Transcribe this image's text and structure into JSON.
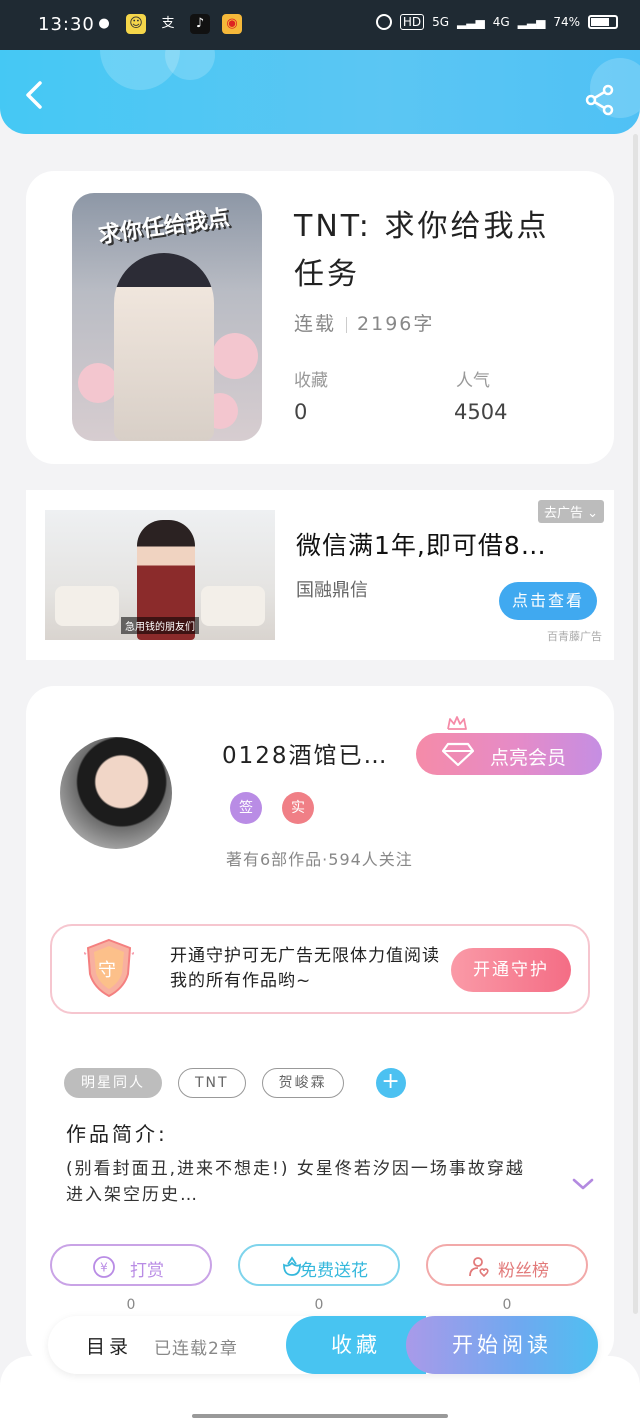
{
  "status_bar": {
    "time": "13:30",
    "apps": [
      "wechat-icon",
      "app-icon",
      "alipay-icon",
      "tiktok-icon",
      "weibo-icon"
    ],
    "hd": "HD",
    "net1": "5G",
    "net2": "4G",
    "battery": "74%"
  },
  "book": {
    "title": "TNT: 求你给我点任务",
    "cover_text": "求你任给我点",
    "status": "连载",
    "words": "2196字",
    "collect_label": "收藏",
    "collect_value": "0",
    "popularity_label": "人气",
    "popularity_value": "4504"
  },
  "ad": {
    "remove_label": "去广告",
    "image_caption": "急用钱的朋友们",
    "title": "微信满1年,即可借8…",
    "subtitle": "国融鼎信",
    "button": "点击查看",
    "source": "百青藤广告"
  },
  "author": {
    "name": "0128酒馆已…",
    "vip_button": "点亮会员",
    "badge_sign": "签",
    "badge_real": "实",
    "stats": "著有6部作品·594人关注",
    "guard_text": "开通守护可无广告无限体力值阅读我的所有作品哟~",
    "guard_icon_text": "守",
    "guard_button": "开通守护"
  },
  "tags": [
    "明星同人",
    "TNT",
    "贺峻霖"
  ],
  "intro": {
    "label": "作品简介:",
    "text": "(别看封面丑,进来不想走!) 女星佟若汐因一场事故穿越进入架空历史…"
  },
  "actions": [
    {
      "label": "打赏",
      "count": "0",
      "color": "#c48fe0"
    },
    {
      "label": "免费送花",
      "count": "0",
      "color": "#4cc3e6"
    },
    {
      "label": "粉丝榜",
      "count": "0",
      "color": "#ef8e8e"
    }
  ],
  "bottom": {
    "toc": "目录",
    "toc_sub": "已连载2章",
    "collect": "收藏",
    "read": "开始阅读"
  },
  "colors": {
    "header": "#45c8f4",
    "accent_blue": "#48c4f1",
    "vip_pink": "#f58ba8",
    "guard_red": "#f46d85"
  }
}
